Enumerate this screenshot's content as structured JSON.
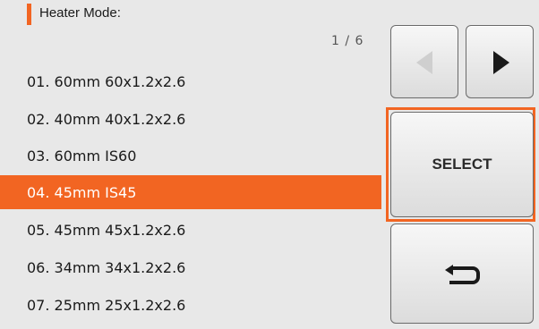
{
  "header": {
    "title": "Heater Mode:"
  },
  "list": {
    "page": "1 / 6",
    "items": [
      {
        "label": "01. 60mm 60x1.2x2.6"
      },
      {
        "label": "02. 40mm 40x1.2x2.6"
      },
      {
        "label": "03. 60mm IS60"
      },
      {
        "label": "04. 45mm IS45"
      },
      {
        "label": "05. 45mm 45x1.2x2.6"
      },
      {
        "label": "06. 34mm 34x1.2x2.6"
      },
      {
        "label": "07. 25mm 25x1.2x2.6"
      }
    ],
    "selected_index": 3
  },
  "buttons": {
    "prev_icon": "triangle-left-icon",
    "next_icon": "triangle-right-icon",
    "select_label": "SELECT",
    "back_icon": "return-arrow-icon",
    "prev_enabled": false
  },
  "colors": {
    "accent": "#f26522",
    "background": "#e8e8e8",
    "disabled_icon": "#cfcfcf",
    "icon": "#1a1a1a"
  }
}
